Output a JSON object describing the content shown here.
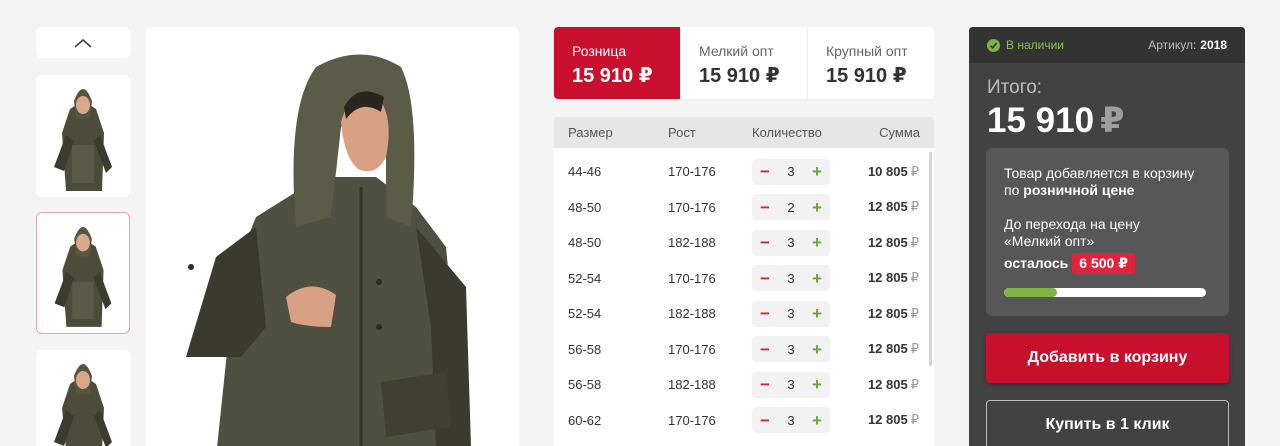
{
  "price_tabs": [
    {
      "label": "Розница",
      "price": "15 910 ₽",
      "active": true
    },
    {
      "label": "Мелкий опт",
      "price": "15 910 ₽",
      "active": false
    },
    {
      "label": "Крупный опт",
      "price": "15 910 ₽",
      "active": false
    }
  ],
  "table": {
    "headers": {
      "size": "Размер",
      "height": "Рост",
      "qty": "Количество",
      "sum": "Сумма"
    },
    "currency": "₽",
    "rows": [
      {
        "size": "44-46",
        "height": "170-176",
        "qty": "3",
        "sum": "10 805"
      },
      {
        "size": "48-50",
        "height": "170-176",
        "qty": "2",
        "sum": "12 805"
      },
      {
        "size": "48-50",
        "height": "182-188",
        "qty": "3",
        "sum": "12 805"
      },
      {
        "size": "52-54",
        "height": "170-176",
        "qty": "3",
        "sum": "12 805"
      },
      {
        "size": "52-54",
        "height": "182-188",
        "qty": "3",
        "sum": "12 805"
      },
      {
        "size": "56-58",
        "height": "170-176",
        "qty": "3",
        "sum": "12 805"
      },
      {
        "size": "56-58",
        "height": "182-188",
        "qty": "3",
        "sum": "12 805"
      },
      {
        "size": "60-62",
        "height": "170-176",
        "qty": "3",
        "sum": "12 805"
      }
    ]
  },
  "panel": {
    "stock": "В наличии",
    "article_label": "Артикул:",
    "article_value": "2018",
    "total_label": "Итого:",
    "total_value": "15 910",
    "total_currency": "₽",
    "notice_line1": "Товар добавляется в корзину",
    "notice_line2_pre": "по ",
    "notice_line2_bold": "розничной цене",
    "notice_p2_line1": "До перехода на цену",
    "notice_p2_line2": "«Мелкий опт»",
    "notice_remaining_label": "осталось",
    "notice_remaining_value": "6 500 ₽",
    "progress_fraction": 0.26,
    "add_to_cart": "Добавить в корзину",
    "buy_one_click": "Купить в 1 клик"
  },
  "colors": {
    "accent": "#c8102e",
    "panel": "#424242",
    "success": "#7cb342"
  },
  "icons": {
    "thumbs_up": "chevron-up-icon",
    "stock": "check-circle-icon"
  }
}
